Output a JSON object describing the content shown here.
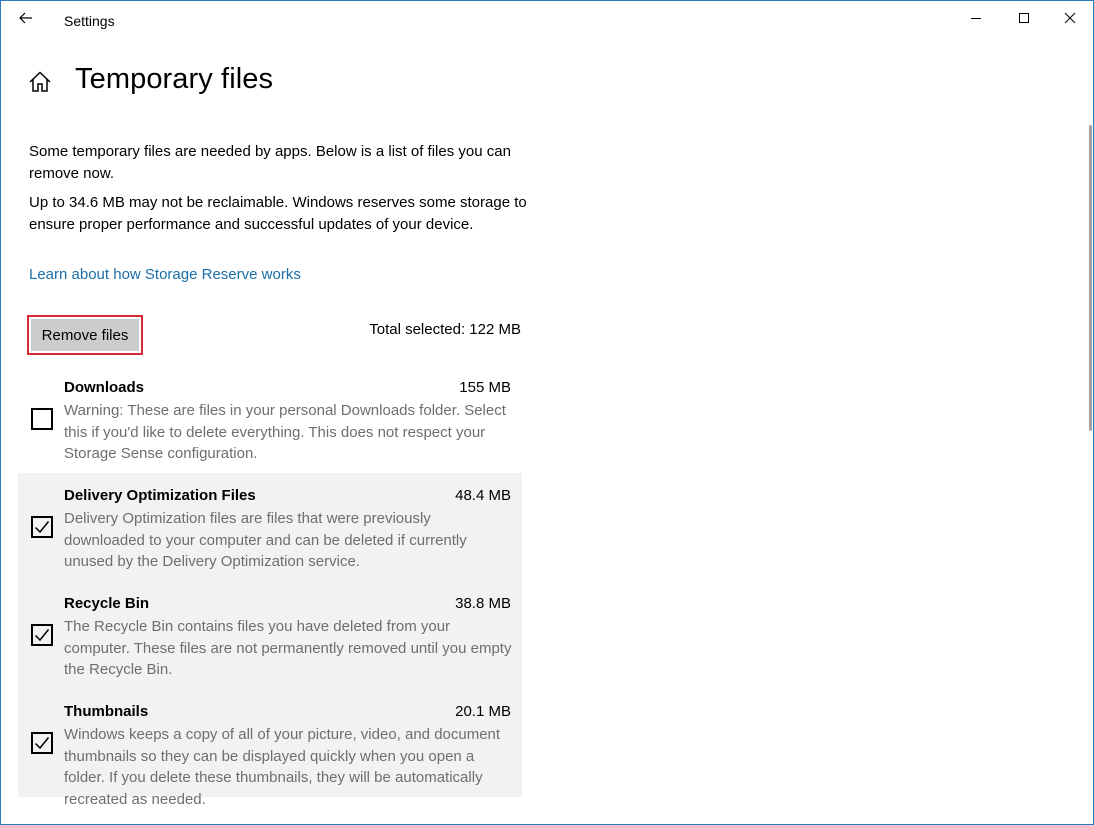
{
  "window": {
    "app_title": "Settings"
  },
  "header": {
    "page_title": "Temporary files"
  },
  "description": {
    "paragraph_1": "Some temporary files are needed by apps. Below is a list of files you can remove now.",
    "paragraph_2": "Up to 34.6 MB may not be reclaimable. Windows reserves some storage to ensure proper performance and successful updates of your device.",
    "link_label": "Learn about how Storage Reserve works"
  },
  "actions": {
    "remove_label": "Remove files",
    "total_selected": "Total selected: 122 MB"
  },
  "items": [
    {
      "name": "Downloads",
      "size": "155 MB",
      "description": "Warning: These are files in your personal Downloads folder. Select this if you'd like to delete everything. This does not respect your Storage Sense configuration.",
      "checked": false
    },
    {
      "name": "Delivery Optimization Files",
      "size": "48.4 MB",
      "description": "Delivery Optimization files are files that were previously downloaded to your computer and can be deleted if currently unused by the Delivery Optimization service.",
      "checked": true
    },
    {
      "name": "Recycle Bin",
      "size": "38.8 MB",
      "description": "The Recycle Bin contains files you have deleted from your computer. These files are not permanently removed until you empty the Recycle Bin.",
      "checked": true
    },
    {
      "name": "Thumbnails",
      "size": "20.1 MB",
      "description": "Windows keeps a copy of all of your picture, video, and document thumbnails so they can be displayed quickly when you open a folder. If you delete these thumbnails, they will be automatically recreated as needed.",
      "checked": true
    }
  ],
  "icons": {
    "back": "arrow-left-icon",
    "home": "home-icon",
    "minimize": "minimize-icon",
    "maximize": "maximize-icon",
    "close": "close-icon",
    "check": "checkmark-icon"
  },
  "colors": {
    "window_border": "#2b78c2",
    "link": "#1a6fa8",
    "highlight": "#d62b35",
    "button_bg": "#cccccc",
    "secondary_text": "#6e6e6e",
    "shaded_row": "#f2f2f2"
  }
}
